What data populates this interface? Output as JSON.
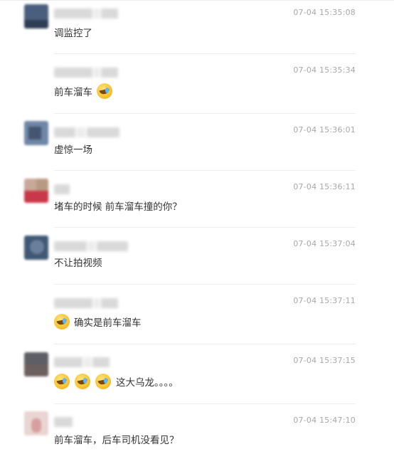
{
  "comments": [
    {
      "time": "07-04 15:35:08",
      "text": "调监控了",
      "emojis_before": 0,
      "emojis_after": 0
    },
    {
      "time": "07-04 15:35:34",
      "text": "前车溜车",
      "emojis_before": 0,
      "emojis_after": 1
    },
    {
      "time": "07-04 15:36:01",
      "text": "虚惊一场",
      "emojis_before": 0,
      "emojis_after": 0
    },
    {
      "time": "07-04 15:36:11",
      "text": "堵车的时候 前车溜车撞的你？",
      "emojis_before": 0,
      "emojis_after": 0
    },
    {
      "time": "07-04 15:37:04",
      "text": "不让拍视频",
      "emojis_before": 0,
      "emojis_after": 0
    },
    {
      "time": "07-04 15:37:11",
      "text": "确实是前车溜车",
      "emojis_before": 1,
      "emojis_after": 0
    },
    {
      "time": "07-04 15:37:15",
      "text": "这大乌龙。。。。",
      "emojis_before": 3,
      "emojis_after": 0
    },
    {
      "time": "07-04 15:47:10",
      "text": "前车溜车，后车司机没看见？",
      "emojis_before": 0,
      "emojis_after": 0
    }
  ],
  "icons": {
    "emoji": "laughing-crying-emoji-icon",
    "avatar": "user-avatar"
  },
  "colors": {
    "time": "#a8a8a8",
    "text": "#333333",
    "separator": "#eeeeee"
  }
}
